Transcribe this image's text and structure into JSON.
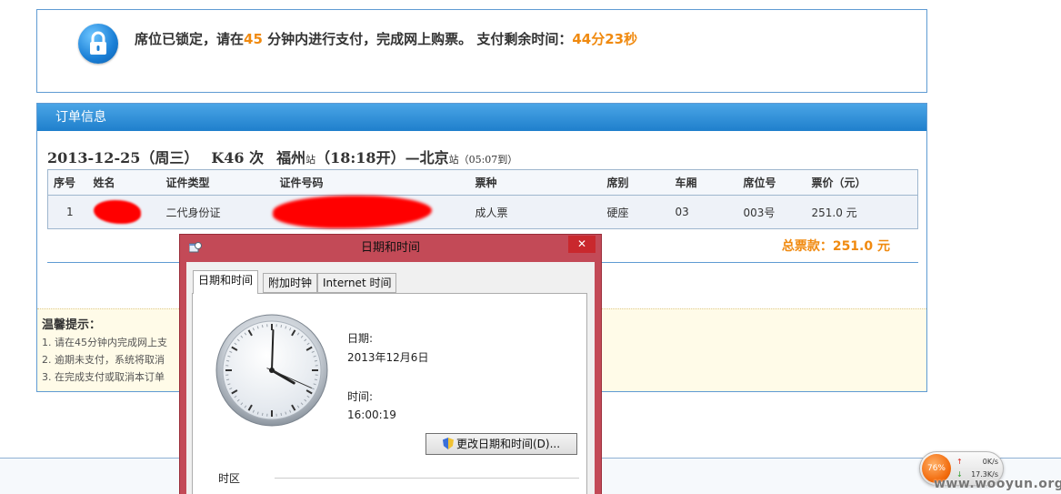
{
  "lock_banner": {
    "text_before": "席位已锁定，请在",
    "minutes": "45",
    "text_middle": " 分钟内进行支付，完成网上购票。 支付剩余时间：",
    "remaining": "44分23秒"
  },
  "order": {
    "header": "订单信息",
    "trip": {
      "date": "2013-12-25（周三）",
      "train": "K46 次",
      "from": "福州",
      "from_suffix": "站",
      "depart": "（18:18开）",
      "dash": "—",
      "to": "北京",
      "to_suffix": "站",
      "arrive": "（05:07到）"
    },
    "columns": [
      "序号",
      "姓名",
      "证件类型",
      "证件号码",
      "票种",
      "席别",
      "车厢",
      "席位号",
      "票价（元）"
    ],
    "rows": [
      {
        "no": "1",
        "id_type": "二代身份证",
        "ticket_type": "成人票",
        "seat_class": "硬座",
        "car": "03",
        "seat_no": "003号",
        "price": "251.0 元"
      }
    ],
    "total": "总票款：251.0 元"
  },
  "tips": {
    "title": "温馨提示：",
    "items": [
      "1. 请在45分钟内完成网上支",
      "2. 逾期未支付，系统将取消",
      "3. 在完成支付或取消本订单"
    ]
  },
  "dialog": {
    "title": "日期和时间",
    "close": "✕",
    "tabs": [
      "日期和时间",
      "附加时钟",
      "Internet 时间"
    ],
    "date_label": "日期:",
    "date_value": "2013年12月6日",
    "time_label": "时间:",
    "time_value": "16:00:19",
    "change_button": "更改日期和时间(D)...",
    "timezone_label": "时区",
    "clock": {
      "hour": 4,
      "minute": 0,
      "second": 19
    }
  },
  "net_widget": {
    "percent": "76%",
    "up": "0K/s",
    "down": "17.3K/s"
  },
  "watermark": "www.wooyun.org",
  "colors": {
    "accent_orange": "#f08a10",
    "panel_border": "#5f9bd3",
    "dialog_frame": "#c34a57",
    "redaction": "#ff0000"
  }
}
